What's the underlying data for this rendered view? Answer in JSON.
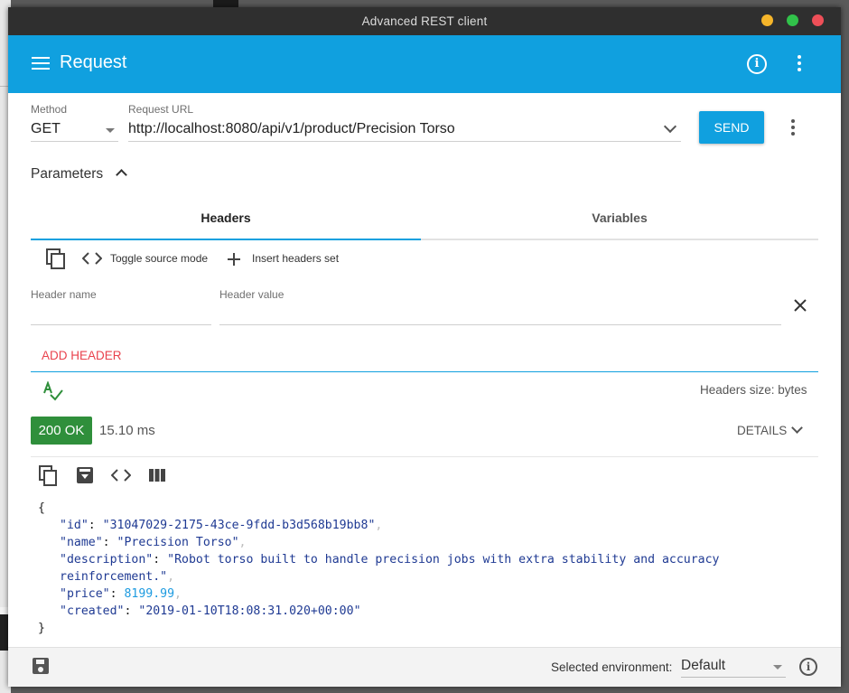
{
  "window": {
    "title": "Advanced REST client"
  },
  "appbar": {
    "title": "Request"
  },
  "request": {
    "method_label": "Method",
    "method": "GET",
    "url_label": "Request URL",
    "url": "http://localhost:8080/api/v1/product/Precision Torso",
    "send_label": "SEND"
  },
  "parameters": {
    "label": "Parameters",
    "tabs": [
      {
        "label": "Headers",
        "active": true
      },
      {
        "label": "Variables",
        "active": false
      }
    ],
    "toolbar": {
      "toggle_label": "Toggle source mode",
      "insert_label": "Insert headers set"
    },
    "header_name_label": "Header name",
    "header_value_label": "Header value",
    "add_header_label": "ADD HEADER",
    "headers_size": "Headers size: bytes"
  },
  "response": {
    "status": "200 OK",
    "timing": "15.10 ms",
    "details_label": "DETAILS",
    "body": {
      "id": "31047029-2175-43ce-9fdd-b3d568b19bb8",
      "name": "Precision Torso",
      "description_line1": "Robot torso built to handle precision jobs with extra stability and accuracy",
      "description_line2": "reinforcement.",
      "price": "8199.99",
      "created": "2019-01-10T18:08:31.020+00:00"
    }
  },
  "footer": {
    "env_label": "Selected environment:",
    "env_value": "Default"
  },
  "colors": {
    "accent": "#10a0df",
    "status_ok": "#2f8f3b",
    "add_header": "#e9424d"
  }
}
